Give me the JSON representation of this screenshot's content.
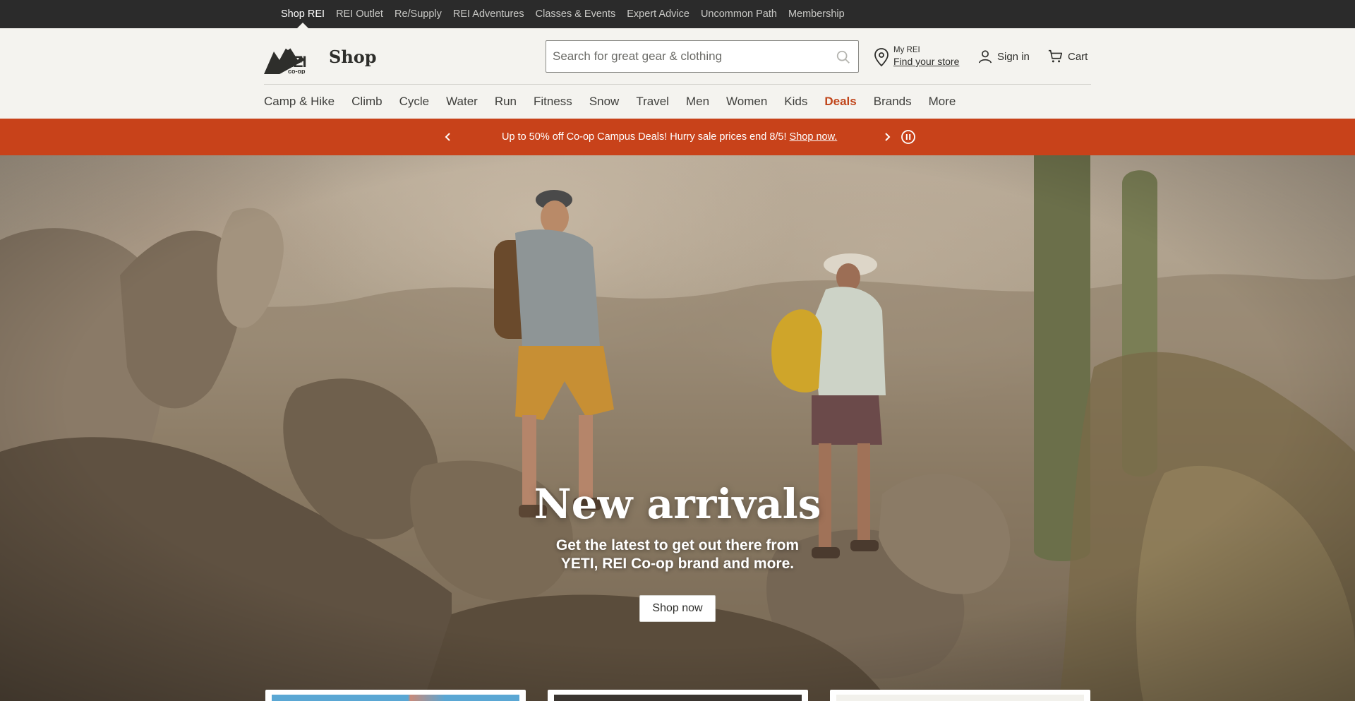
{
  "topbar": {
    "items": [
      {
        "label": "Shop REI",
        "active": true
      },
      {
        "label": "REI Outlet"
      },
      {
        "label": "Re/Supply"
      },
      {
        "label": "REI Adventures"
      },
      {
        "label": "Classes & Events"
      },
      {
        "label": "Expert Advice"
      },
      {
        "label": "Uncommon Path"
      },
      {
        "label": "Membership"
      }
    ]
  },
  "header": {
    "logo_text": "REI co-op",
    "shop_title": "Shop",
    "search_placeholder": "Search for great gear & clothing",
    "my_rei": "My REI",
    "find_store": "Find your store",
    "sign_in": "Sign in",
    "cart": "Cart"
  },
  "nav": {
    "items": [
      "Camp & Hike",
      "Climb",
      "Cycle",
      "Water",
      "Run",
      "Fitness",
      "Snow",
      "Travel",
      "Men",
      "Women",
      "Kids",
      "Deals",
      "Brands",
      "More"
    ]
  },
  "promo": {
    "text": "Up to 50% off Co-op Campus Deals! Hurry sale prices end 8/5!",
    "link": "Shop now."
  },
  "hero": {
    "title": "New arrivals",
    "subtitle": "Get the latest to get out there from YETI, REI Co-op brand and more.",
    "button": "Shop now"
  },
  "colors": {
    "topbar": "#2b2b2b",
    "header_bg": "#f4f3ef",
    "promo_bg": "#c8421a",
    "deals": "#c0451a"
  }
}
